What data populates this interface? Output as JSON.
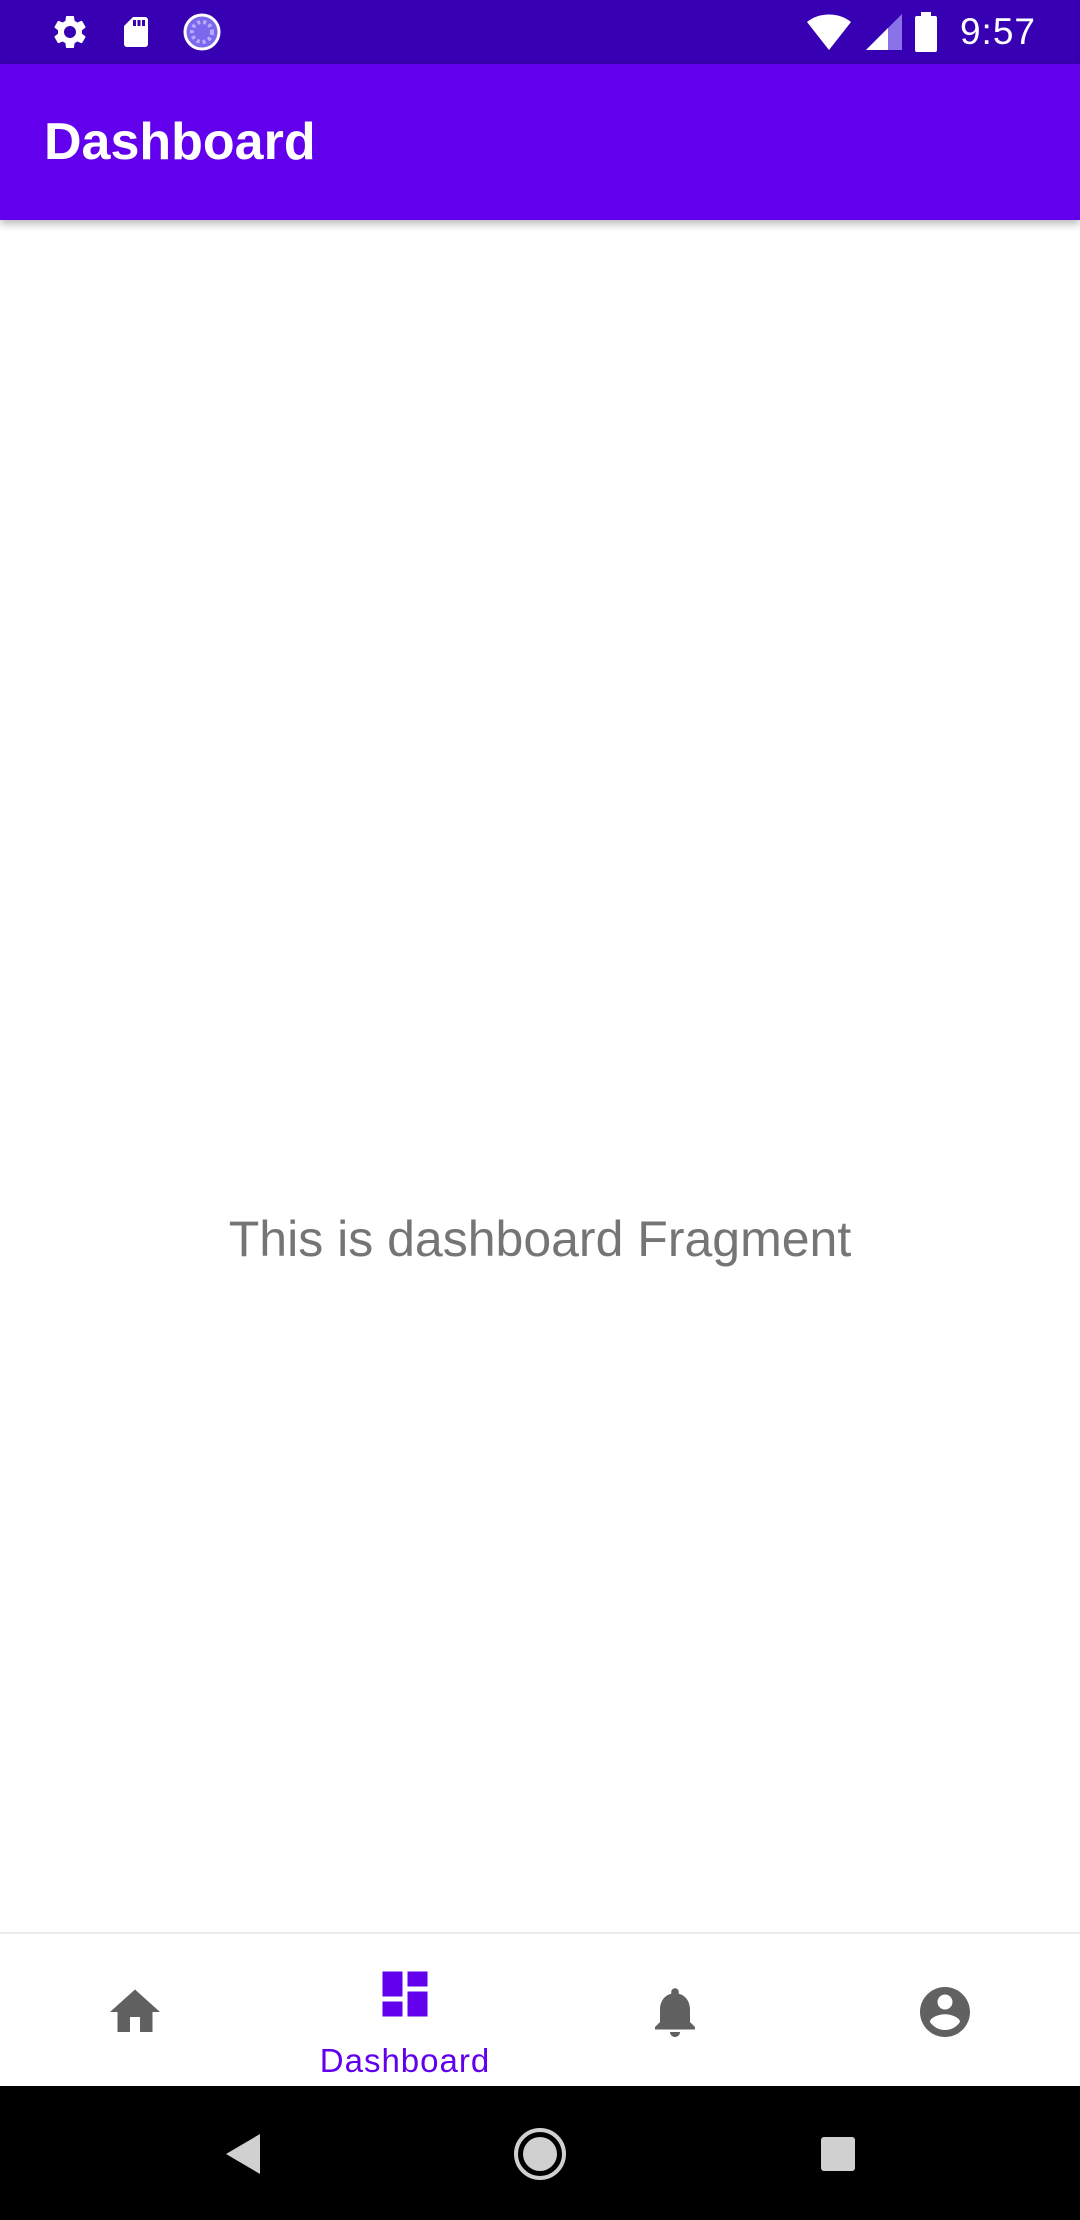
{
  "status_bar": {
    "time": "9:57",
    "left_icons": [
      "settings-icon",
      "sd-card-icon",
      "sync-icon"
    ],
    "right_icons": [
      "wifi-icon",
      "cellular-signal-icon",
      "battery-icon"
    ],
    "background": "#3700b3"
  },
  "app_bar": {
    "title": "Dashboard",
    "background": "#6200ee"
  },
  "content": {
    "message": "This is dashboard Fragment"
  },
  "bottom_nav": {
    "items": [
      {
        "id": "home",
        "icon": "home-icon",
        "label": "",
        "active": false
      },
      {
        "id": "dashboard",
        "icon": "dashboard-icon",
        "label": "Dashboard",
        "active": true
      },
      {
        "id": "notifications",
        "icon": "bell-icon",
        "label": "",
        "active": false
      },
      {
        "id": "profile",
        "icon": "account-circle-icon",
        "label": "",
        "active": false
      }
    ],
    "active_color": "#6200ee",
    "inactive_color": "#616161"
  },
  "system_nav": {
    "buttons": [
      "back-icon",
      "home-circle-icon",
      "recents-icon"
    ]
  }
}
